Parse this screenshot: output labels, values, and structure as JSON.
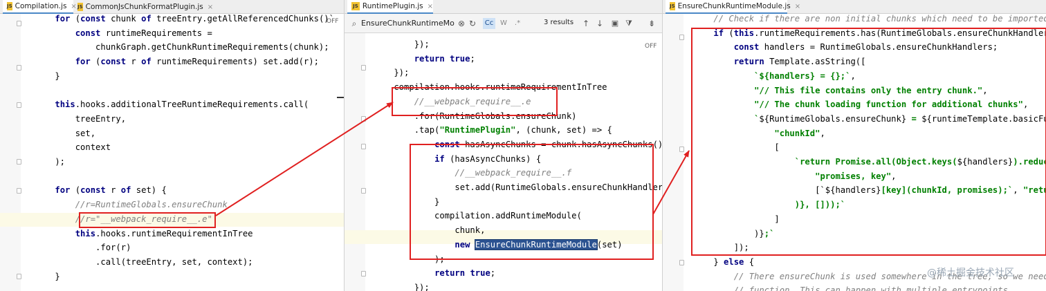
{
  "tabs": {
    "panel1": [
      {
        "label": "Compilation.js",
        "icon": "js-icon"
      },
      {
        "label": "CommonJsChunkFormatPlugin.js",
        "icon": "js-icon"
      }
    ],
    "panel2": [
      {
        "label": "RuntimePlugin.js",
        "icon": "js-icon"
      }
    ],
    "panel3": [
      {
        "label": "EnsureChunkRuntimeModule.js",
        "icon": "js-icon"
      }
    ]
  },
  "search": {
    "query": "EnsureChunkRuntimeMo",
    "results": "3 results",
    "match_case": "Cc",
    "whole_word": "W",
    "regex": ".*"
  },
  "off_label": "OFF",
  "watermark": "@稀土掘金技术社区",
  "colors": {
    "keyword": "#000080",
    "string": "#008000",
    "comment": "#808080",
    "highlight_box": "#e02020",
    "current_line": "#fcfae6",
    "selection": "#2c5391"
  },
  "panel1_lines": [
    [
      {
        "t": "    "
      },
      {
        "t": "for",
        "c": "kw"
      },
      {
        "t": " ("
      },
      {
        "t": "const",
        "c": "kw"
      },
      {
        "t": " chunk "
      },
      {
        "t": "of",
        "c": "kw"
      },
      {
        "t": " treeEntry.getAllReferencedChunks()`"
      }
    ],
    [
      {
        "t": "        "
      },
      {
        "t": "const",
        "c": "kw"
      },
      {
        "t": " runtimeRequirements ="
      }
    ],
    [
      {
        "t": "            chunkGraph.getChunkRuntimeRequirements(chunk);"
      }
    ],
    [
      {
        "t": "        "
      },
      {
        "t": "for",
        "c": "kw"
      },
      {
        "t": " ("
      },
      {
        "t": "const",
        "c": "kw"
      },
      {
        "t": " r "
      },
      {
        "t": "of",
        "c": "kw"
      },
      {
        "t": " runtimeRequirements) set.add(r);"
      }
    ],
    [
      {
        "t": "    }"
      }
    ],
    [
      {
        "t": ""
      }
    ],
    [
      {
        "t": "    "
      },
      {
        "t": "this",
        "c": "kw"
      },
      {
        "t": ".hooks.additionalTreeRuntimeRequirements.call("
      }
    ],
    [
      {
        "t": "        treeEntry,"
      }
    ],
    [
      {
        "t": "        set,"
      }
    ],
    [
      {
        "t": "        context"
      }
    ],
    [
      {
        "t": "    );"
      }
    ],
    [
      {
        "t": ""
      }
    ],
    [
      {
        "t": "    "
      },
      {
        "t": "for",
        "c": "kw"
      },
      {
        "t": " ("
      },
      {
        "t": "const",
        "c": "kw"
      },
      {
        "t": " r "
      },
      {
        "t": "of",
        "c": "kw"
      },
      {
        "t": " set) {"
      }
    ],
    [
      {
        "t": "        "
      },
      {
        "t": "//r=RuntimeGlobals.ensureChunk",
        "c": "cm"
      }
    ],
    [
      {
        "t": "        "
      },
      {
        "t": "//r=\"__webpack_require__.e\"",
        "c": "cm"
      }
    ],
    [
      {
        "t": "        "
      },
      {
        "t": "this",
        "c": "kw"
      },
      {
        "t": ".hooks.runtimeRequirementInTree"
      }
    ],
    [
      {
        "t": "            .for(r)"
      }
    ],
    [
      {
        "t": "            .call(treeEntry, set, context);"
      }
    ],
    [
      {
        "t": "    }"
      }
    ]
  ],
  "panel2_lines": [
    [
      {
        "t": "        });"
      }
    ],
    [
      {
        "t": "        "
      },
      {
        "t": "return",
        "c": "kw"
      },
      {
        "t": " "
      },
      {
        "t": "true",
        "c": "kw"
      },
      {
        "t": ";"
      }
    ],
    [
      {
        "t": "    });"
      }
    ],
    [
      {
        "t": "    compilation.hooks.runtimeRequirementInTree"
      }
    ],
    [
      {
        "t": "        "
      },
      {
        "t": "//__webpack_require__.e",
        "c": "cm"
      }
    ],
    [
      {
        "t": "        .for(RuntimeGlobals.ensureChunk)"
      }
    ],
    [
      {
        "t": "        .tap("
      },
      {
        "t": "\"RuntimePlugin\"",
        "c": "str"
      },
      {
        "t": ", (chunk, set) => {"
      }
    ],
    [
      {
        "t": "            "
      },
      {
        "t": "const",
        "c": "kw"
      },
      {
        "t": " hasAsyncChunks = chunk.hasAsyncChunks();"
      }
    ],
    [
      {
        "t": "            "
      },
      {
        "t": "if",
        "c": "kw"
      },
      {
        "t": " (hasAsyncChunks) {"
      }
    ],
    [
      {
        "t": "                "
      },
      {
        "t": "//__webpack_require__.f",
        "c": "cm"
      }
    ],
    [
      {
        "t": "                set.add(RuntimeGlobals.ensureChunkHandlers);"
      }
    ],
    [
      {
        "t": "            }"
      }
    ],
    [
      {
        "t": "            compilation.addRuntimeModule("
      }
    ],
    [
      {
        "t": "                chunk,"
      }
    ],
    [
      {
        "t": "                "
      },
      {
        "t": "new",
        "c": "kw"
      },
      {
        "t": " "
      },
      {
        "t": "EnsureChunkRuntimeModule",
        "c": "sel"
      },
      {
        "t": "(set)"
      }
    ],
    [
      {
        "t": "            );"
      }
    ],
    [
      {
        "t": "            "
      },
      {
        "t": "return",
        "c": "kw"
      },
      {
        "t": " "
      },
      {
        "t": "true",
        "c": "kw"
      },
      {
        "t": ";"
      }
    ],
    [
      {
        "t": "        });"
      }
    ]
  ],
  "panel3_lines": [
    [
      {
        "t": "    "
      },
      {
        "t": "// Check if there are non initial chunks which need to be imported using",
        "c": "cm"
      }
    ],
    [
      {
        "t": "    "
      },
      {
        "t": "if",
        "c": "kw"
      },
      {
        "t": " ("
      },
      {
        "t": "this",
        "c": "kw"
      },
      {
        "t": ".runtimeRequirements.has(RuntimeGlobals.ensureChunkHandlers)) {"
      }
    ],
    [
      {
        "t": "        "
      },
      {
        "t": "const",
        "c": "kw"
      },
      {
        "t": " handlers = RuntimeGlobals.ensureChunkHandlers;"
      }
    ],
    [
      {
        "t": "        "
      },
      {
        "t": "return",
        "c": "kw"
      },
      {
        "t": " Template.asString(["
      }
    ],
    [
      {
        "t": "            `${handlers}",
        "c": "str"
      },
      {
        "t": " = {};`",
        "c": "str"
      },
      {
        "t": ","
      }
    ],
    [
      {
        "t": "            "
      },
      {
        "t": "\"// This file contains only the entry chunk.\"",
        "c": "str"
      },
      {
        "t": ","
      }
    ],
    [
      {
        "t": "            "
      },
      {
        "t": "\"// The chunk loading function for additional chunks\"",
        "c": "str"
      },
      {
        "t": ","
      }
    ],
    [
      {
        "t": "            "
      },
      {
        "t": "`",
        "c": "str"
      },
      {
        "t": "${RuntimeGlobals.ensureChunk} "
      },
      {
        "t": "=",
        "c": "str"
      },
      {
        "t": " ${runtimeTemplate.basicFunction("
      }
    ],
    [
      {
        "t": "                "
      },
      {
        "t": "\"chunkId\"",
        "c": "str"
      },
      {
        "t": ","
      }
    ],
    [
      {
        "t": "                ["
      }
    ],
    [
      {
        "t": "                    "
      },
      {
        "t": "`return Promise.all(Object.keys(",
        "c": "str"
      },
      {
        "t": "${handlers}"
      },
      {
        "t": ").reduce(",
        "c": "str"
      },
      {
        "t": "${ru"
      }
    ],
    [
      {
        "t": "                        "
      },
      {
        "t": "\"promises, key\"",
        "c": "str"
      },
      {
        "t": ","
      }
    ],
    [
      {
        "t": "                        [`"
      },
      {
        "t": "${handlers}"
      },
      {
        "t": "[key](chunkId, promises);`",
        "c": "str"
      },
      {
        "t": ", "
      },
      {
        "t": "\"return pro",
        "c": "str"
      }
    ],
    [
      {
        "t": "                    )}, []));`",
        "c": "str"
      }
    ],
    [
      {
        "t": "                ]"
      }
    ],
    [
      {
        "t": "            )}"
      },
      {
        "t": ";`",
        "c": "str"
      }
    ],
    [
      {
        "t": "        ]);"
      }
    ],
    [
      {
        "t": "    } "
      },
      {
        "t": "else",
        "c": "kw"
      },
      {
        "t": " {"
      }
    ],
    [
      {
        "t": "        "
      },
      {
        "t": "// There ensureChunk is used somewhere in the tree, so we need an em",
        "c": "cm"
      }
    ],
    [
      {
        "t": "        "
      },
      {
        "t": "// function. This can happen with multiple entrypoints.",
        "c": "cm"
      }
    ]
  ]
}
